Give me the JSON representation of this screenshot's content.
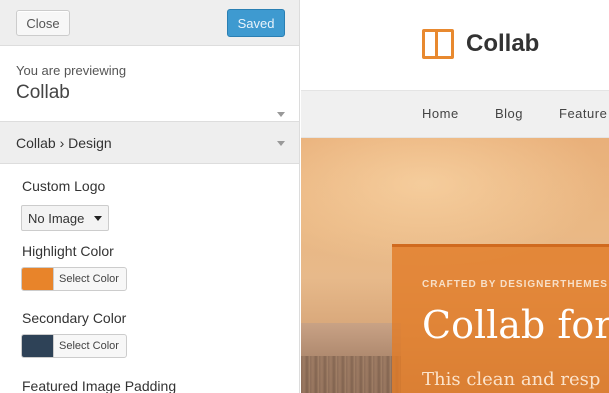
{
  "header": {
    "close_label": "Close",
    "saved_label": "Saved"
  },
  "preview_info": {
    "label": "You are previewing",
    "theme_name": "Collab"
  },
  "section": {
    "title": "Collab › Design"
  },
  "controls": {
    "custom_logo": {
      "title": "Custom Logo",
      "selected": "No Image"
    },
    "highlight_color": {
      "title": "Highlight Color",
      "button_label": "Select Color",
      "value": "#e8842a"
    },
    "secondary_color": {
      "title": "Secondary Color",
      "button_label": "Select Color",
      "value": "#2e4257"
    },
    "featured_padding": {
      "title": "Featured Image Padding"
    }
  },
  "site": {
    "logo_text": "Collab",
    "nav": [
      "Home",
      "Blog",
      "Feature"
    ],
    "hero_kicker": "CRAFTED BY DESIGNERTHEMES",
    "hero_title": "Collab for",
    "hero_subtitle": "This clean and resp"
  },
  "colors": {
    "accent": "#e8892f",
    "button_primary": "#3e9ad0"
  }
}
